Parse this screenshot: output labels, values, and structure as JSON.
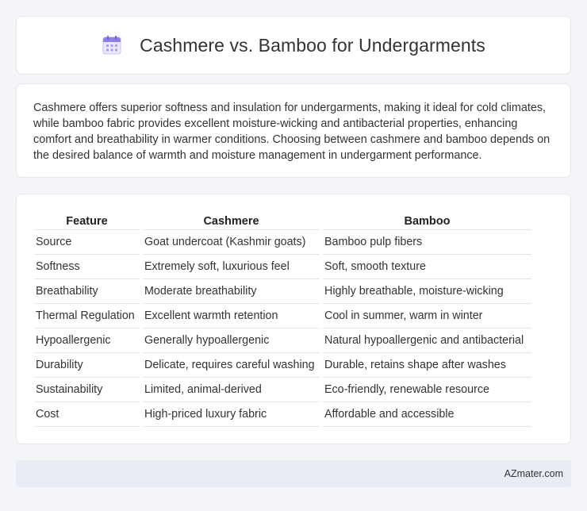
{
  "header": {
    "title": "Cashmere vs. Bamboo for Undergarments",
    "icon": "calendar-icon"
  },
  "intro": {
    "text": "Cashmere offers superior softness and insulation for undergarments, making it ideal for cold climates, while bamboo fabric provides excellent moisture-wicking and antibacterial properties, enhancing comfort and breathability in warmer conditions. Choosing between cashmere and bamboo depends on the desired balance of warmth and moisture management in undergarment performance."
  },
  "table": {
    "headers": [
      "Feature",
      "Cashmere",
      "Bamboo"
    ],
    "rows": [
      [
        "Source",
        "Goat undercoat (Kashmir goats)",
        "Bamboo pulp fibers"
      ],
      [
        "Softness",
        "Extremely soft, luxurious feel",
        "Soft, smooth texture"
      ],
      [
        "Breathability",
        "Moderate breathability",
        "Highly breathable, moisture-wicking"
      ],
      [
        "Thermal Regulation",
        "Excellent warmth retention",
        "Cool in summer, warm in winter"
      ],
      [
        "Hypoallergenic",
        "Generally hypoallergenic",
        "Natural hypoallergenic and antibacterial"
      ],
      [
        "Durability",
        "Delicate, requires careful washing",
        "Durable, retains shape after washes"
      ],
      [
        "Sustainability",
        "Limited, animal-derived",
        "Eco-friendly, renewable resource"
      ],
      [
        "Cost",
        "High-priced luxury fabric",
        "Affordable and accessible"
      ]
    ]
  },
  "footer": {
    "text": "AZmater.com"
  }
}
